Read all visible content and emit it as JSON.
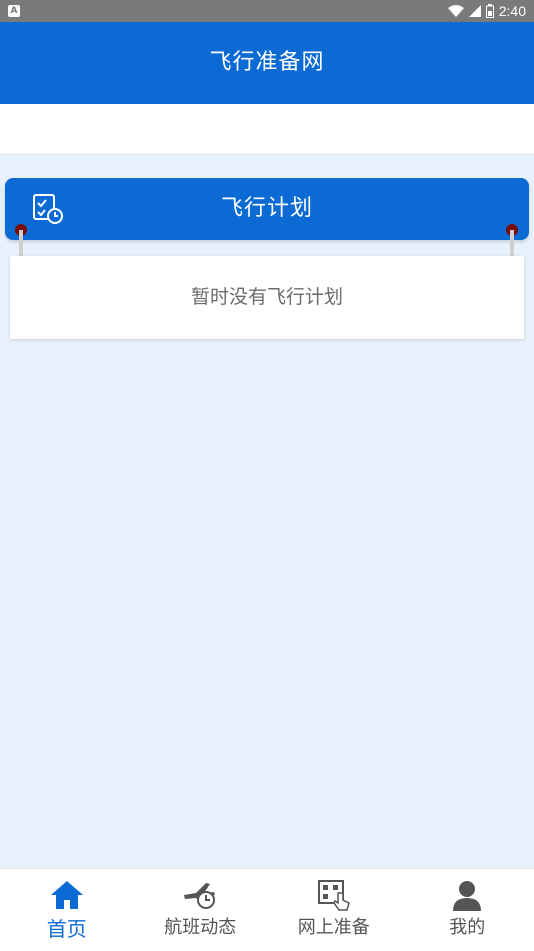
{
  "status_bar": {
    "left_icon": "A",
    "time": "2:40",
    "icons": [
      "wifi-icon",
      "signal-icon",
      "battery-icon"
    ]
  },
  "app_bar": {
    "title": "飞行准备网"
  },
  "plan_card": {
    "title": "飞行计划",
    "empty_text": "暂时没有飞行计划",
    "icon": "calendar-clock-icon"
  },
  "bottom_nav": {
    "items": [
      {
        "label": "首页",
        "icon": "home-icon",
        "active": true
      },
      {
        "label": "航班动态",
        "icon": "plane-clock-icon",
        "active": false
      },
      {
        "label": "网上准备",
        "icon": "qr-touch-icon",
        "active": false
      },
      {
        "label": "我的",
        "icon": "user-icon",
        "active": false
      }
    ]
  },
  "colors": {
    "primary": "#0b6ad3",
    "background": "#e8f1fb",
    "status_bar": "#7a7a7a",
    "inactive_nav": "#555555"
  }
}
